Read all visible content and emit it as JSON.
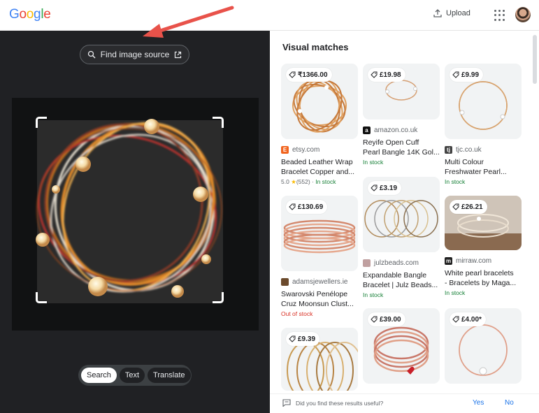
{
  "header": {
    "logo_letters": [
      {
        "ch": "G",
        "color": "#4285F4"
      },
      {
        "ch": "o",
        "color": "#EA4335"
      },
      {
        "ch": "o",
        "color": "#FBBC05"
      },
      {
        "ch": "g",
        "color": "#4285F4"
      },
      {
        "ch": "l",
        "color": "#34A853"
      },
      {
        "ch": "e",
        "color": "#EA4335"
      }
    ],
    "upload_label": "Upload",
    "icons": {
      "upload": "upload-icon",
      "apps": "apps-grid-icon",
      "avatar": "user-avatar"
    }
  },
  "lens": {
    "find_source_label": "Find image source",
    "find_source_icons": [
      "lens-search-icon",
      "open-external-icon"
    ],
    "modes": [
      {
        "label": "Search",
        "active": true
      },
      {
        "label": "Text",
        "active": false
      },
      {
        "label": "Translate",
        "active": false
      }
    ],
    "annotation_arrow_color": "#e8524a"
  },
  "results": {
    "title": "Visual matches",
    "items": [
      {
        "price": "₹1366.00",
        "site": "etsy.com",
        "favicon": {
          "letter": "E",
          "color": "#f1641e"
        },
        "title": [
          "Beaded Leather Wrap",
          "Bracelet Copper and..."
        ],
        "rating": "5.0",
        "reviews": "(552)",
        "stock": "In stock",
        "stock_status": "in",
        "thumb": "bracelet-rosegold-multi"
      },
      {
        "price": "£130.69",
        "site": "adamsjewellers.ie",
        "favicon": {
          "letter": "",
          "color": "#6b4a2c"
        },
        "title": [
          "Swarovski Penélope",
          "Cruz Moonsun Clust..."
        ],
        "stock": "Out of stock",
        "stock_status": "out",
        "thumb": "bangle-stack-rosegold"
      },
      {
        "price": "£9.39",
        "thumb": "bangles-gold-open"
      },
      {
        "price": "£19.98",
        "site": "amazon.co.uk",
        "favicon": {
          "letter": "a",
          "color": "#111111"
        },
        "title": [
          "Reyife Open Cuff",
          "Pearl Bangle 14K Gol..."
        ],
        "stock": "In stock",
        "stock_status": "in",
        "thumb": "cuff-pearl-small"
      },
      {
        "price": "£3.19",
        "site": "julzbeads.com",
        "favicon": {
          "letter": "",
          "color": "#c0a0a0"
        },
        "title": [
          "Expandable Bangle",
          "Bracelet | Julz Beads..."
        ],
        "stock": "In stock",
        "stock_status": "in",
        "thumb": "wire-bangles-row"
      },
      {
        "price": "£39.00",
        "thumb": "bangles-rosegold-heart"
      },
      {
        "price": "£9.99",
        "site": "tjc.co.uk",
        "favicon": {
          "letter": "tj",
          "color": "#444444"
        },
        "title": [
          "Multi Colour",
          "Freshwater Pearl..."
        ],
        "stock": "In stock",
        "stock_status": "in",
        "thumb": "pearl-bangles-gold"
      },
      {
        "price": "£26.21",
        "site": "mirraw.com",
        "favicon": {
          "letter": "m",
          "color": "#222222"
        },
        "title": [
          "White pearl bracelets",
          "- Bracelets by Maga..."
        ],
        "stock": "In stock",
        "stock_status": "in",
        "thumb": "pearl-bracelet-photo"
      },
      {
        "price": "£4.00*",
        "thumb": "single-pearl-bangle"
      }
    ]
  },
  "feedback": {
    "question": "Did you find these results useful?",
    "yes_label": "Yes",
    "no_label": "No",
    "icon": "feedback-icon"
  }
}
